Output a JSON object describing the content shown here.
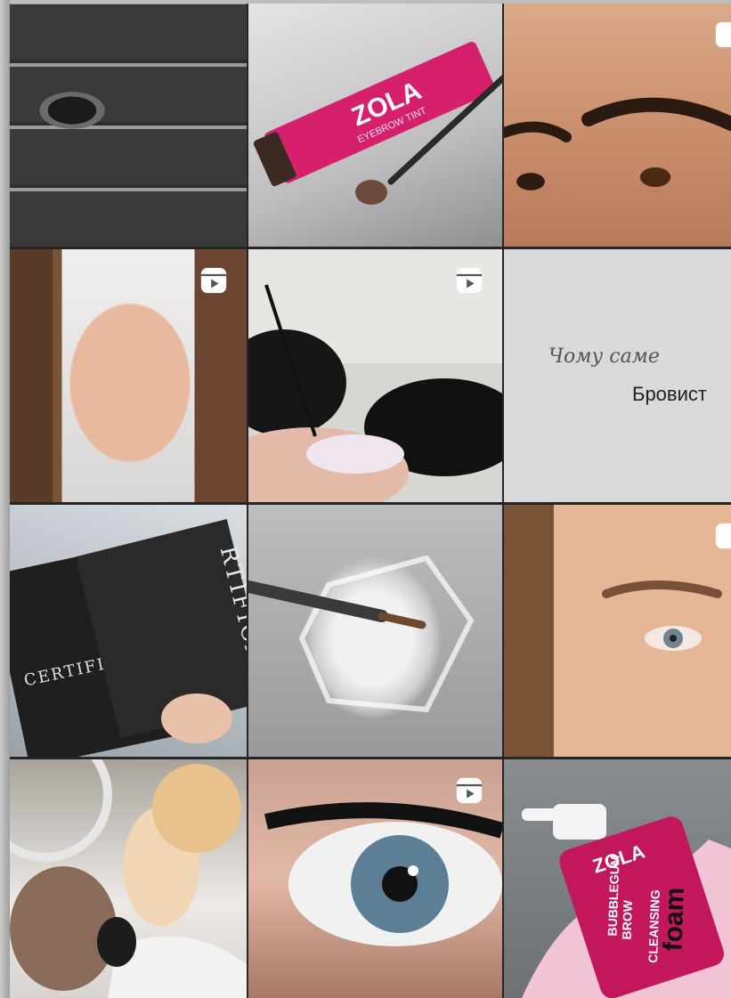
{
  "feed": {
    "tiles": [
      {
        "index": 0,
        "subject": "eyelashes-collage",
        "is_reel": false
      },
      {
        "index": 1,
        "subject": "brow-dye-tube",
        "is_reel": false,
        "brand": "ZOLA",
        "product": "EYEBROW TINT"
      },
      {
        "index": 2,
        "subject": "brows-closeup",
        "is_reel": true
      },
      {
        "index": 3,
        "subject": "client-portrait",
        "is_reel": true
      },
      {
        "index": 4,
        "subject": "brow-procedure",
        "is_reel": true
      },
      {
        "index": 5,
        "subject": "text-post",
        "is_reel": false,
        "script_text": "Чому саме",
        "main_text": "Бровист"
      },
      {
        "index": 6,
        "subject": "certificates",
        "is_reel": false,
        "sheet_title": "CERTIFICATE",
        "sheet_title_2": "RTIFICATE"
      },
      {
        "index": 7,
        "subject": "brush-in-glass",
        "is_reel": false
      },
      {
        "index": 8,
        "subject": "brow-result",
        "is_reel": true
      },
      {
        "index": 9,
        "subject": "master-at-work",
        "is_reel": false
      },
      {
        "index": 10,
        "subject": "blue-eye-closeup",
        "is_reel": true
      },
      {
        "index": 11,
        "subject": "cleansing-foam",
        "is_reel": false,
        "brand": "ZOLA",
        "product_line1": "BUBBLEGUM",
        "product_line2": "BROW",
        "product_line3": "CLEANSING",
        "product_line4": "foam"
      }
    ]
  },
  "colors": {
    "background": "#262626",
    "zola_pink": "#d6206e",
    "foam_pink": "#c2185b",
    "reel_icon": "#ffffff"
  },
  "icons": {
    "reel": "reels-icon"
  }
}
